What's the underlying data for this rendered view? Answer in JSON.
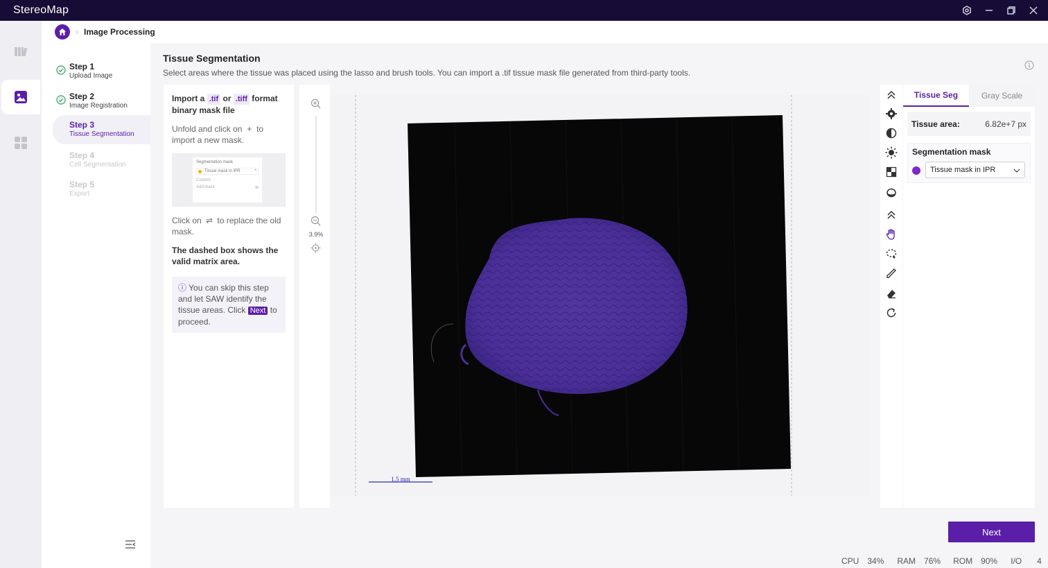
{
  "app": {
    "title": "StereoMap"
  },
  "window": {
    "controls": [
      "settings-icon",
      "minimize-icon",
      "restore-icon",
      "close-icon"
    ]
  },
  "rail": {
    "items": [
      "library-icon",
      "image-processing-icon",
      "apps-icon"
    ],
    "active_index": 1
  },
  "breadcrumb": {
    "current": "Image Processing"
  },
  "steps": [
    {
      "label": "Step 1",
      "sub": "Upload Image",
      "state": "done"
    },
    {
      "label": "Step 2",
      "sub": "Image Registration",
      "state": "done"
    },
    {
      "label": "Step 3",
      "sub": "Tissue Segmentation",
      "state": "active"
    },
    {
      "label": "Step 4",
      "sub": "Cell Segmentation",
      "state": "disabled"
    },
    {
      "label": "Step 5",
      "sub": "Export",
      "state": "disabled"
    }
  ],
  "main": {
    "title": "Tissue Segmentation",
    "description": "Select areas where the tissue was placed using the lasso and brush tools. You can import a .tif tissue mask file generated from third-party tools."
  },
  "instructions": {
    "import_prefix": "Import a",
    "tif": ".tif",
    "or": "or",
    "tiff": ".tiff",
    "import_suffix": "format binary mask file",
    "unfold_prefix": "Unfold and click on",
    "plus": "+",
    "unfold_suffix": "to import a new mask.",
    "preview_title": "Segmentation mask",
    "preview_item": "Tissue mask in IPR",
    "preview_custom": "Custom",
    "preview_add": "Add mask",
    "replace_prefix": "Click on",
    "replace_glyph": "⇌",
    "replace_suffix": "to replace the old mask.",
    "dashed_note": "The dashed box shows the valid matrix area.",
    "tip_prefix": "You can skip this step and let SAW identify the tissue areas. Click",
    "tip_next": "Next",
    "tip_suffix": "to proceed."
  },
  "zoom": {
    "percent": "3.9%",
    "level": 0.039
  },
  "canvas": {
    "scale_bar_label": "1.5 mm"
  },
  "tools": [
    "collapse-up-icon",
    "settings-gear-icon",
    "contrast-icon",
    "brightness-icon",
    "checker-icon",
    "ink-drop-icon",
    "collapse-up-icon",
    "hand-icon",
    "lasso-icon",
    "brush-icon",
    "eraser-icon",
    "redo-icon"
  ],
  "right_panel": {
    "tab_active": "Tissue Seg",
    "tab_other": "Gray Scale",
    "area_label": "Tissue area:",
    "area_value": "6.82e+7 px",
    "mask_title": "Segmentation mask",
    "mask_selected": "Tissue mask in IPR",
    "mask_color": "#7d28c7"
  },
  "next_button": "Next",
  "status": {
    "cpu_label": "CPU",
    "cpu_value": "34%",
    "ram_label": "RAM",
    "ram_value": "76%",
    "rom_label": "ROM",
    "rom_value": "90%",
    "io_label": "I/O",
    "io_value": "4"
  },
  "colors": {
    "accent": "#5b1ea8",
    "titlebar": "#160c36",
    "tissue": "#5a3fa8"
  }
}
